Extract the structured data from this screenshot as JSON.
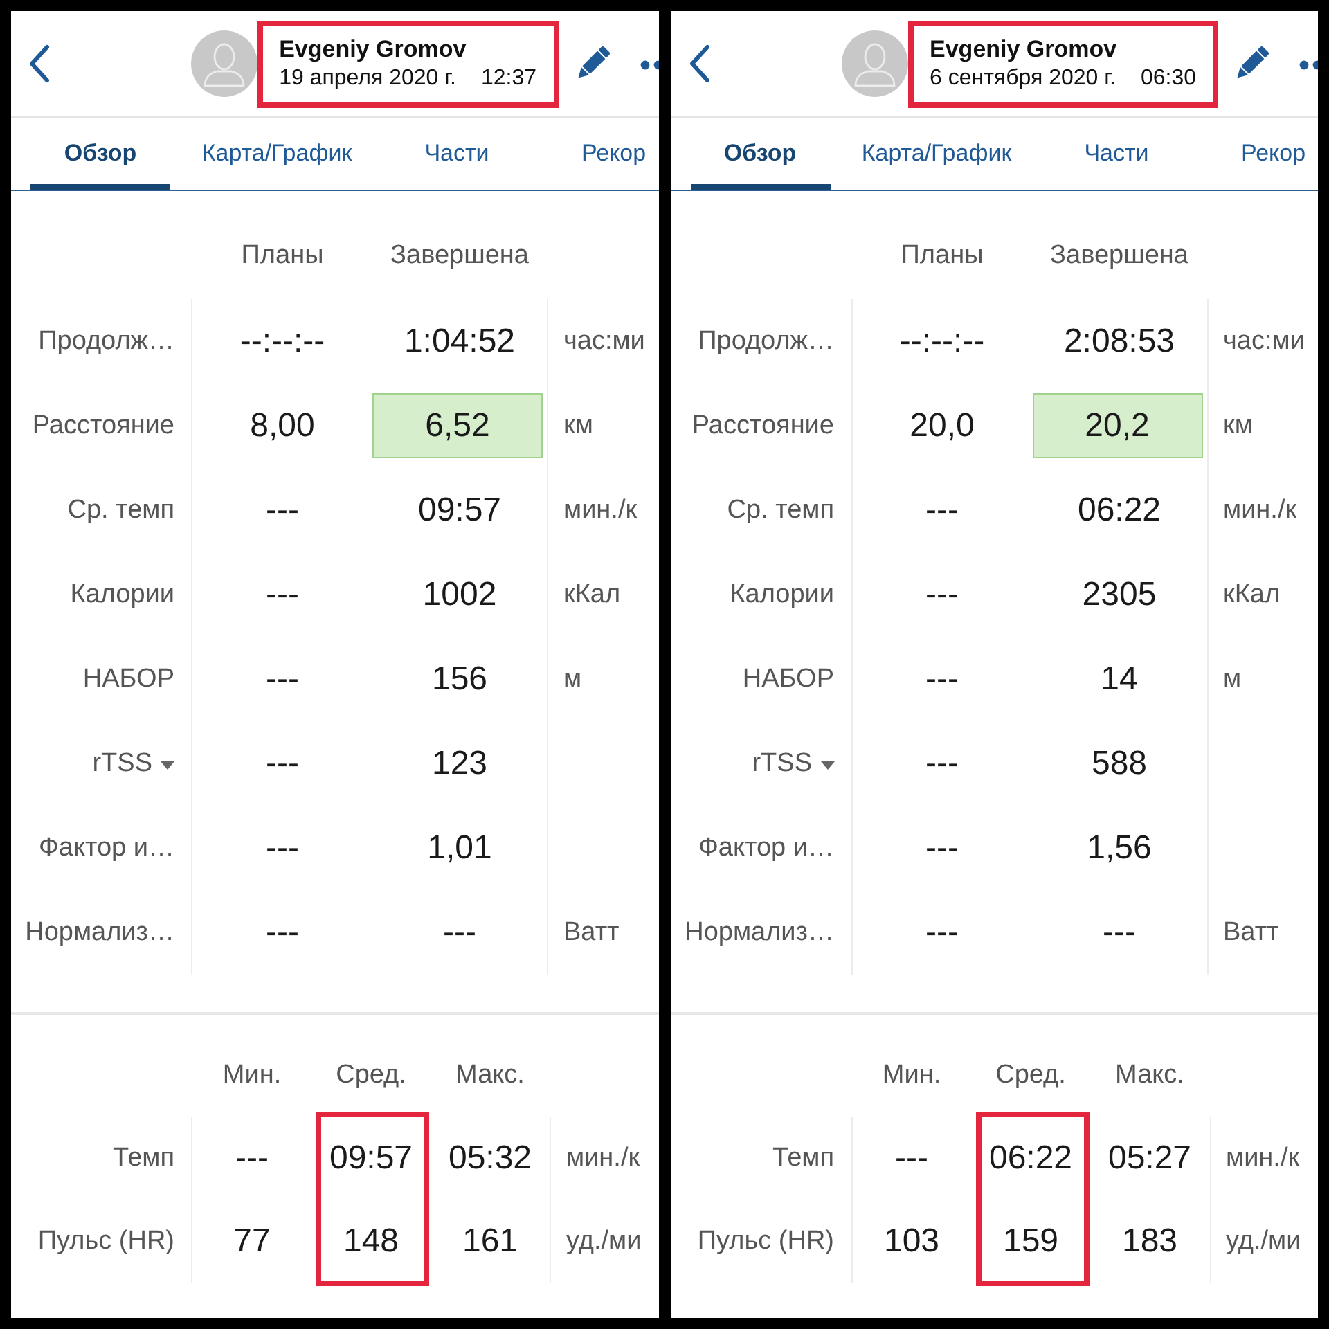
{
  "panels": [
    {
      "header": {
        "name": "Evgeniy Gromov",
        "date": "19 апреля 2020 г.",
        "time": "12:37",
        "highlighted": true
      },
      "tabs": [
        {
          "label": "Обзор",
          "selected": true
        },
        {
          "label": "Карта/График",
          "selected": false
        },
        {
          "label": "Части",
          "selected": false
        },
        {
          "label": "Рекор",
          "selected": false
        }
      ],
      "summary": {
        "columns": [
          "Планы",
          "Завершена"
        ],
        "rows": [
          {
            "label": "Продолж…",
            "planned": "--:--:--",
            "completed": "1:04:52",
            "unit": "час:ми",
            "completed_highlighted": false,
            "dropdown": false
          },
          {
            "label": "Расстояние",
            "planned": "8,00",
            "completed": "6,52",
            "unit": "км",
            "completed_highlighted": true,
            "dropdown": false
          },
          {
            "label": "Ср. темп",
            "planned": "---",
            "completed": "09:57",
            "unit": "мин./к",
            "completed_highlighted": false,
            "dropdown": false
          },
          {
            "label": "Калории",
            "planned": "---",
            "completed": "1002",
            "unit": "кКал",
            "completed_highlighted": false,
            "dropdown": false
          },
          {
            "label": "НАБОР",
            "planned": "---",
            "completed": "156",
            "unit": "м",
            "completed_highlighted": false,
            "dropdown": false
          },
          {
            "label": "rTSS",
            "planned": "---",
            "completed": "123",
            "completed_highlighted": false,
            "dropdown": true
          },
          {
            "label": "Фактор и…",
            "planned": "---",
            "completed": "1,01",
            "completed_highlighted": false,
            "dropdown": false
          },
          {
            "label": "Нормализ…",
            "planned": "---",
            "completed": "---",
            "unit": "Ватт",
            "completed_highlighted": false,
            "dropdown": false
          }
        ]
      },
      "stats": {
        "columns": [
          {
            "label": "Мин.",
            "highlighted": false
          },
          {
            "label": "Сред.",
            "highlighted": true
          },
          {
            "label": "Макс.",
            "highlighted": false
          }
        ],
        "rows": [
          {
            "label": "Темп",
            "values": [
              "---",
              "09:57",
              "05:32"
            ],
            "unit": "мин./к"
          },
          {
            "label": "Пульс (HR)",
            "values": [
              "77",
              "148",
              "161"
            ],
            "unit": "уд./ми"
          }
        ]
      }
    },
    {
      "header": {
        "name": "Evgeniy Gromov",
        "date": "6 сентября 2020 г.",
        "time": "06:30",
        "highlighted": true
      },
      "tabs": [
        {
          "label": "Обзор",
          "selected": true
        },
        {
          "label": "Карта/График",
          "selected": false
        },
        {
          "label": "Части",
          "selected": false
        },
        {
          "label": "Рекор",
          "selected": false
        }
      ],
      "summary": {
        "columns": [
          "Планы",
          "Завершена"
        ],
        "rows": [
          {
            "label": "Продолж…",
            "planned": "--:--:--",
            "completed": "2:08:53",
            "unit": "час:ми",
            "completed_highlighted": false,
            "dropdown": false
          },
          {
            "label": "Расстояние",
            "planned": "20,0",
            "completed": "20,2",
            "unit": "км",
            "completed_highlighted": true,
            "dropdown": false
          },
          {
            "label": "Ср. темп",
            "planned": "---",
            "completed": "06:22",
            "unit": "мин./к",
            "completed_highlighted": false,
            "dropdown": false
          },
          {
            "label": "Калории",
            "planned": "---",
            "completed": "2305",
            "unit": "кКал",
            "completed_highlighted": false,
            "dropdown": false
          },
          {
            "label": "НАБОР",
            "planned": "---",
            "completed": "14",
            "unit": "м",
            "completed_highlighted": false,
            "dropdown": false
          },
          {
            "label": "rTSS",
            "planned": "---",
            "completed": "588",
            "completed_highlighted": false,
            "dropdown": true
          },
          {
            "label": "Фактор и…",
            "planned": "---",
            "completed": "1,56",
            "completed_highlighted": false,
            "dropdown": false
          },
          {
            "label": "Нормализ…",
            "planned": "---",
            "completed": "---",
            "unit": "Ватт",
            "completed_highlighted": false,
            "dropdown": false
          }
        ]
      },
      "stats": {
        "columns": [
          {
            "label": "Мин.",
            "highlighted": false
          },
          {
            "label": "Сред.",
            "highlighted": true
          },
          {
            "label": "Макс.",
            "highlighted": false
          }
        ],
        "rows": [
          {
            "label": "Темп",
            "values": [
              "---",
              "06:22",
              "05:27"
            ],
            "unit": "мин./к"
          },
          {
            "label": "Пульс (HR)",
            "values": [
              "103",
              "159",
              "183"
            ],
            "unit": "уд./ми"
          }
        ]
      }
    }
  ]
}
